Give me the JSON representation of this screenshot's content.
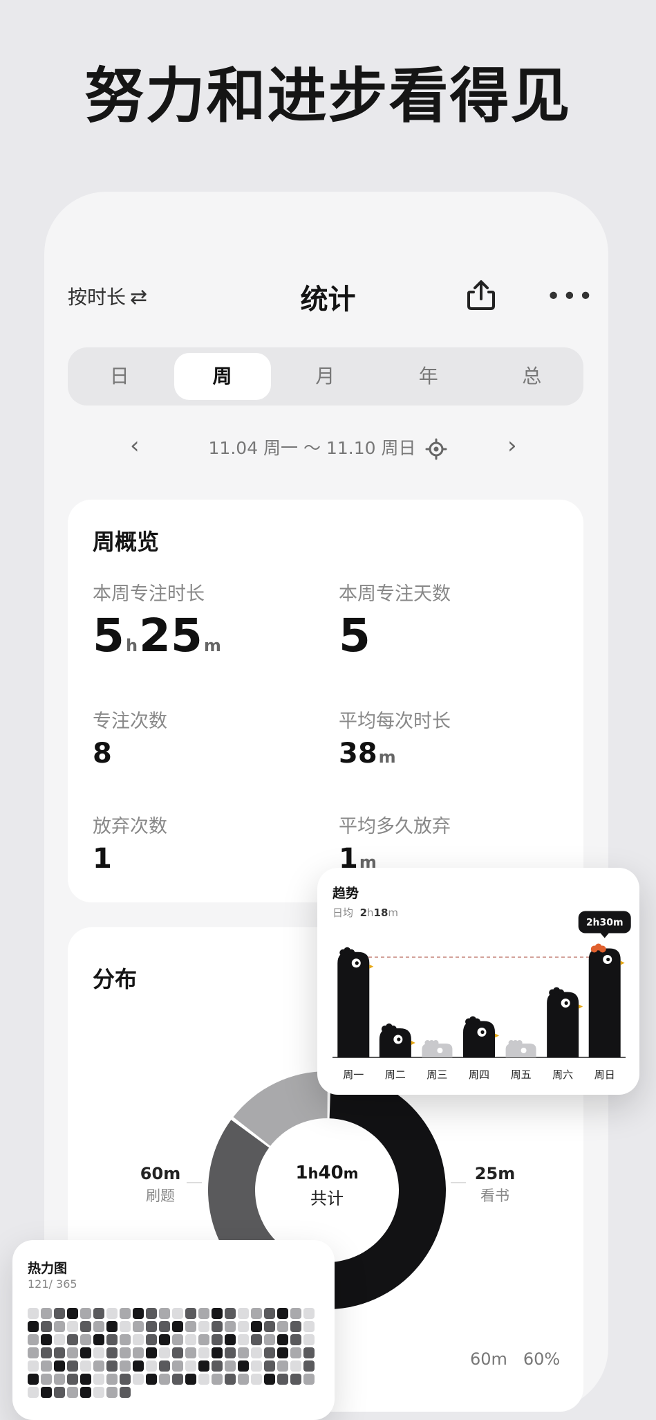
{
  "headline": "努力和进步看得见",
  "topbar": {
    "mode": "按时长",
    "swap_glyph": "⇄",
    "title": "统计"
  },
  "tabs": [
    "日",
    "周",
    "月",
    "年",
    "总"
  ],
  "active_tab": "周",
  "range": {
    "text": "11.04 周一 ～ 11.10 周日"
  },
  "overview": {
    "title": "周概览",
    "focus_time_label": "本周专注时长",
    "focus_time_h": "5",
    "focus_time_m": "25",
    "focus_days_label": "本周专注天数",
    "focus_days": "5",
    "sessions_label": "专注次数",
    "sessions": "8",
    "avg_label": "平均每次时长",
    "avg_value": "38",
    "quit_label": "放弃次数",
    "quit_value": "1",
    "avg_quit_label": "平均多久放弃",
    "avg_quit_value": "1"
  },
  "distribution": {
    "title": "分布",
    "center_h": "1",
    "center_m": "40",
    "center_label": "共计",
    "left_value": "60m",
    "left_label": "刷题",
    "right_value": "25m",
    "right_label": "看书",
    "bottom_minutes": "60m",
    "bottom_percent": "60%"
  },
  "units": {
    "h": "h",
    "m": "m"
  },
  "trend": {
    "title": "趋势",
    "sub_label": "日均",
    "sub_h": "2",
    "sub_m": "18",
    "tooltip": "2h30m",
    "colors": {
      "bar": "#121214",
      "empty": "#c9c9cc",
      "avg_line": "#c88a80",
      "comb": "#e0602e"
    }
  },
  "chart_data": {
    "type": "bar",
    "categories": [
      "周一",
      "周二",
      "周三",
      "周四",
      "周五",
      "周六",
      "周日"
    ],
    "values": [
      145,
      40,
      0,
      50,
      0,
      90,
      150
    ],
    "unit": "minutes",
    "average": 138,
    "ylim": [
      0,
      160
    ]
  },
  "donut_data": {
    "segments": [
      {
        "value": 60,
        "color": "#121214"
      },
      {
        "value": 25,
        "color": "#5a5a5c"
      },
      {
        "value": 15,
        "color": "#a9a9ab"
      }
    ]
  },
  "heatmap": {
    "title": "热力图",
    "count": "121/ 365",
    "levels": [
      0,
      1,
      2,
      3,
      1,
      2,
      0,
      1,
      3,
      2,
      1,
      0,
      2,
      1,
      3,
      2,
      0,
      1,
      2,
      3,
      1,
      0,
      3,
      2,
      1,
      0,
      2,
      1,
      3,
      0,
      1,
      2,
      2,
      3,
      1,
      0,
      2,
      1,
      0,
      3,
      2,
      1,
      2,
      0,
      1,
      3,
      0,
      2,
      1,
      3,
      2,
      1,
      0,
      2,
      3,
      1,
      0,
      1,
      2,
      3,
      0,
      2,
      1,
      3,
      2,
      0,
      1,
      2,
      2,
      1,
      3,
      0,
      2,
      1,
      1,
      3,
      0,
      2,
      1,
      0,
      3,
      2,
      1,
      0,
      2,
      3,
      1,
      2,
      0,
      1,
      3,
      2,
      0,
      1,
      2,
      1,
      3,
      0,
      2,
      1,
      0,
      3,
      2,
      1,
      3,
      0,
      2,
      1,
      0,
      2,
      3,
      1,
      1,
      2,
      3,
      0,
      1,
      2,
      0,
      3,
      1,
      2,
      3,
      0,
      1,
      2,
      1,
      0,
      3,
      2,
      2,
      1,
      0,
      3,
      2,
      1,
      3,
      0,
      1,
      2
    ],
    "colors": [
      "#dcdcde",
      "#a9a9ac",
      "#5a5a5d",
      "#161618"
    ]
  }
}
